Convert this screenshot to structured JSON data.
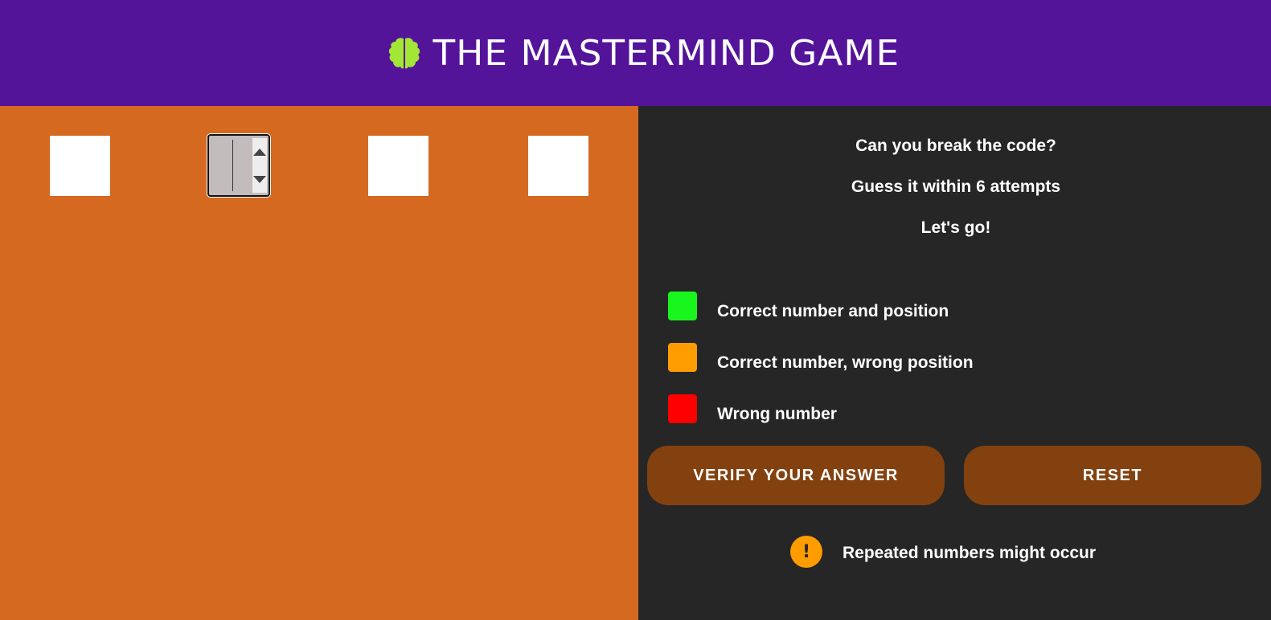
{
  "header": {
    "title": "THE MASTERMIND GAME",
    "icon": "brain-icon",
    "background": "#54149a",
    "icon_color": "#a3e635"
  },
  "board": {
    "background": "#d4691f",
    "slots": [
      {
        "value": "",
        "focused": false
      },
      {
        "value": "",
        "focused": true
      },
      {
        "value": "",
        "focused": false
      },
      {
        "value": "",
        "focused": false
      }
    ]
  },
  "panel": {
    "intro": [
      "Can you break the code?",
      "Guess it within 6 attempts",
      "Let's go!"
    ],
    "legend": [
      {
        "color": "#19f61d",
        "label": "Correct number and position"
      },
      {
        "color": "#ff9c00",
        "label": "Correct number, wrong position"
      },
      {
        "color": "#ff0000",
        "label": "Wrong number"
      }
    ],
    "buttons": {
      "verify_label": "VERIFY YOUR ANSWER",
      "reset_label": "RESET"
    },
    "note": {
      "icon": "exclamation-icon",
      "icon_glyph": "!",
      "text": "Repeated numbers might occur"
    }
  }
}
